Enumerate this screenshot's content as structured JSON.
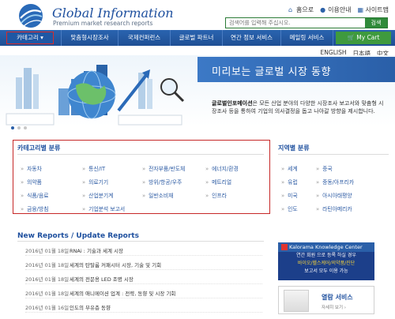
{
  "header": {
    "logo_title": "Global Information",
    "logo_subtitle": "Premium market research reports",
    "links": [
      {
        "label": "홈으로",
        "icon": "home-icon"
      },
      {
        "label": "이용안내",
        "icon": "info-icon"
      },
      {
        "label": "사이트맵",
        "icon": "sitemap-icon"
      }
    ],
    "search_placeholder": "검색어를 입력해 주십시오.",
    "search_button": "검색"
  },
  "nav": {
    "category": "카테고리 ▾",
    "items": [
      "맞춤형시장조사",
      "국제컨퍼런스",
      "글로벌 파트너",
      "연간 정보 서비스",
      "메일링 서비스"
    ],
    "cart": "My Cart"
  },
  "languages": [
    "ENGLISH",
    "日本語",
    "中文"
  ],
  "banner": {
    "title": "미리보는 글로벌 시장 동향",
    "desc_bold": "글로벌인포메이션",
    "desc": "은 모든 산업 분야의 다양한 시장조사 보고서와 맞춤형 시장조사 등을 통하여 기업의 의사결정을 돕고 나아갈 방향을 제시합니다."
  },
  "categories": {
    "title": "카테고리별 분류",
    "items": [
      "자동차",
      "통신/IT",
      "전자부품/반도체",
      "에너지/환경",
      "의약품",
      "의료기기",
      "방위/항공/우주",
      "메트리얼",
      "식품/음료",
      "산업분기계",
      "일반소비재",
      "인프라",
      "금융/방침",
      "기업분석 보고서"
    ]
  },
  "regions": {
    "title": "지역별 분류",
    "items": [
      "세계",
      "중국",
      "유럽",
      "중동/아프리카",
      "미국",
      "아시아태평양",
      "인도",
      "라틴아메리카"
    ]
  },
  "new_reports": {
    "title": "New Reports / Update Reports",
    "rows": [
      {
        "date": "2016년 01월 18일",
        "text": "RNAi : 기술과 세계 시장"
      },
      {
        "date": "2016년 01월 18일",
        "text": "세계의 탄탈룸 커패시터 시장, 기술 및 기회"
      },
      {
        "date": "2016년 01월 18일",
        "text": "세계의 전문용 LED 조명 시장"
      },
      {
        "date": "2016년 01월 18일",
        "text": "세계의 애니메이션 업계 : 전략, 동향 및 시장 기회"
      },
      {
        "date": "2016년 01월 16일",
        "text": "인도의 부유층 동향"
      }
    ]
  },
  "ads": {
    "kalorama_title": "Kalorama Knowledge Center",
    "kalorama_line1": "연간 회원 으로 등록 하실 경우",
    "kalorama_line2": "바이오/헬스케어/의약품/진단",
    "kalorama_line3": "보고서 모두 이용 가능",
    "service_title": "열람 서비스",
    "service_sub": "자세히 보기 ›"
  }
}
